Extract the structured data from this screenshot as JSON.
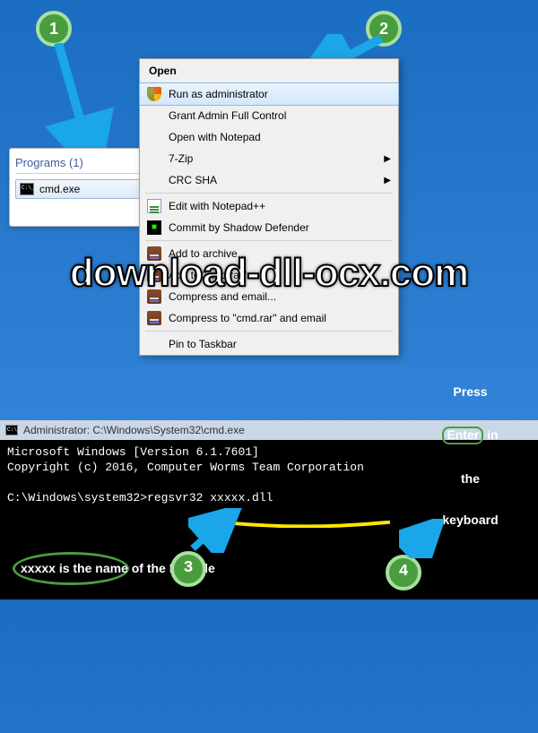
{
  "steps": {
    "s1": "1",
    "s2": "2",
    "s3": "3",
    "s4": "4"
  },
  "programs": {
    "header": "Programs (1)",
    "item": "cmd.exe"
  },
  "context_menu": {
    "title": "Open",
    "items": [
      {
        "label": "Run as administrator",
        "highlighted": true,
        "icon": "shield"
      },
      {
        "label": "Grant Admin Full Control"
      },
      {
        "label": "Open with Notepad"
      },
      {
        "label": "7-Zip",
        "submenu": true
      },
      {
        "label": "CRC SHA",
        "submenu": true
      },
      {
        "sep": true
      },
      {
        "label": "Edit with Notepad++",
        "icon": "notepad"
      },
      {
        "label": "Commit by Shadow Defender",
        "icon": "block"
      },
      {
        "sep": true
      },
      {
        "label": "Add to archive...",
        "icon": "rar"
      },
      {
        "label": "Add to \"cmd.rar\"",
        "icon": "rar"
      },
      {
        "label": "Compress and email...",
        "icon": "rar"
      },
      {
        "label": "Compress to \"cmd.rar\" and email",
        "icon": "rar"
      },
      {
        "sep": true
      },
      {
        "label": "Pin to Taskbar"
      }
    ]
  },
  "watermark": "download-dll-ocx.com",
  "cmd": {
    "title": "Administrator: C:\\Windows\\System32\\cmd.exe",
    "line1": "Microsoft Windows [Version 6.1.7601]",
    "line2": "Copyright (c) 2016, Computer Worms Team Corporation",
    "prompt": "C:\\Windows\\system32>",
    "command": "regsvr32 xxxxx.dll"
  },
  "callouts": {
    "left": "xxxxx is the name of the DLL file",
    "right_pre": "Press",
    "right_key": "Enter",
    "right_post1": "in",
    "right_post2": "the",
    "right_post3": "keyboard"
  }
}
